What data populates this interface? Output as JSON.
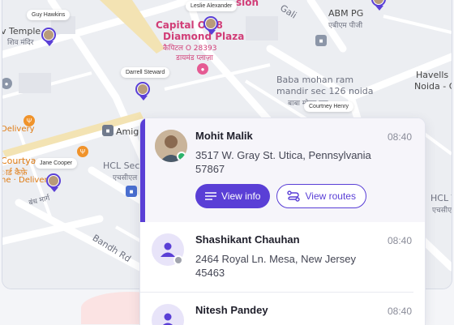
{
  "map": {
    "labels": {
      "capital": "Capital O 28",
      "diamond": "Diamond Plaza",
      "capital_hindi": "कैपिटल O 28393",
      "diamond_hindi": "डायमंड प्लाज़ा",
      "fusion": "sion",
      "gali": "Gali",
      "abm": "ABM PG",
      "abm_hindi": "एबीएम पीजी",
      "temple": "v Temple",
      "temple_hindi": "शिव मंदिर",
      "baba": "Baba mohan ram",
      "baba2": "mandir sec 126 noida",
      "baba_hindi": "बाबा मोहन राम",
      "havells": "Havells In",
      "havells2": "Noida - C",
      "delivery": "Delivery",
      "courtyard": "Courtyar",
      "courtyard_hindi": "ार्ड कैफ़े",
      "courtyard_delivery": "ne · Delivery",
      "amigo": "Amigo",
      "hcl": "HCL Sect",
      "hcl_hindi": "एचसीएल से",
      "hcl_right": "HCL T",
      "hcl_right_hindi": "एचसीए",
      "bandh": "बंध मार्ग",
      "bandh_rd": "Bandh Rd",
      "pink_top": "h"
    },
    "drivers": {
      "guy": "Guy Hawkins",
      "leslie": "Leslie Alexander",
      "darrell": "Darrell Steward",
      "courtney": "Courtney Henry",
      "jane": "Jane Cooper"
    }
  },
  "cards": [
    {
      "name": "Mohit Malik",
      "time": "08:40",
      "address": "3517 W. Gray St. Utica, Pennsylvania 57867",
      "view_info": "View info",
      "view_routes": "View routes",
      "status_color": "#2bb36b"
    },
    {
      "name": "Shashikant Chauhan",
      "time": "08:40",
      "address": "2464 Royal Ln. Mesa, New Jersey 45463",
      "status_color": "#a0a3ad"
    },
    {
      "name": "Nitesh Pandey",
      "time": "08:40"
    }
  ],
  "colors": {
    "accent": "#5a3fd6",
    "online": "#2bb36b",
    "offline": "#a0a3ad"
  }
}
